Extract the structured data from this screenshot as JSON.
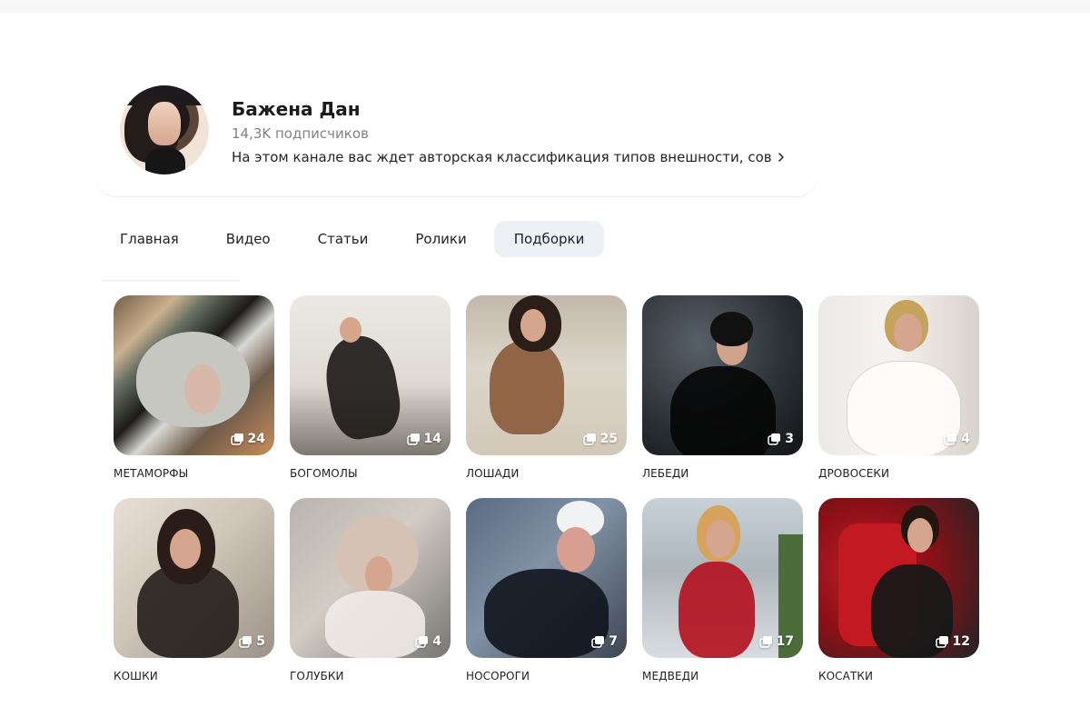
{
  "channel": {
    "name": "Бажена Дан",
    "subscribers": "14,3K подписчиков",
    "description": "На этом канале вас ждет авторская классификация типов внешности, советы ...",
    "avatar_icon": "profile-photo"
  },
  "tabs": [
    {
      "label": "Главная",
      "active": false
    },
    {
      "label": "Видео",
      "active": false
    },
    {
      "label": "Статьи",
      "active": false
    },
    {
      "label": "Ролики",
      "active": false
    },
    {
      "label": "Подборки",
      "active": true
    }
  ],
  "collections": [
    {
      "title": "МЕТАМОРФЫ",
      "count": "24"
    },
    {
      "title": "БОГОМОЛЫ",
      "count": "14"
    },
    {
      "title": "ЛОШАДИ",
      "count": "25"
    },
    {
      "title": "ЛЕБЕДИ",
      "count": "3"
    },
    {
      "title": "ДРОВОСЕКИ",
      "count": "4"
    },
    {
      "title": "КОШКИ",
      "count": "5"
    },
    {
      "title": "ГОЛУБКИ",
      "count": "4"
    },
    {
      "title": "НОСОРОГИ",
      "count": "7"
    },
    {
      "title": "МЕДВЕДИ",
      "count": "17"
    },
    {
      "title": "КОСАТКИ",
      "count": "12"
    }
  ],
  "icons": {
    "description_arrow": "chevron-right-icon",
    "collection_count": "stack-icon"
  },
  "colors": {
    "active_tab": "#edf0f4",
    "muted_text": "#828282",
    "badge_text": "#ffffff"
  }
}
